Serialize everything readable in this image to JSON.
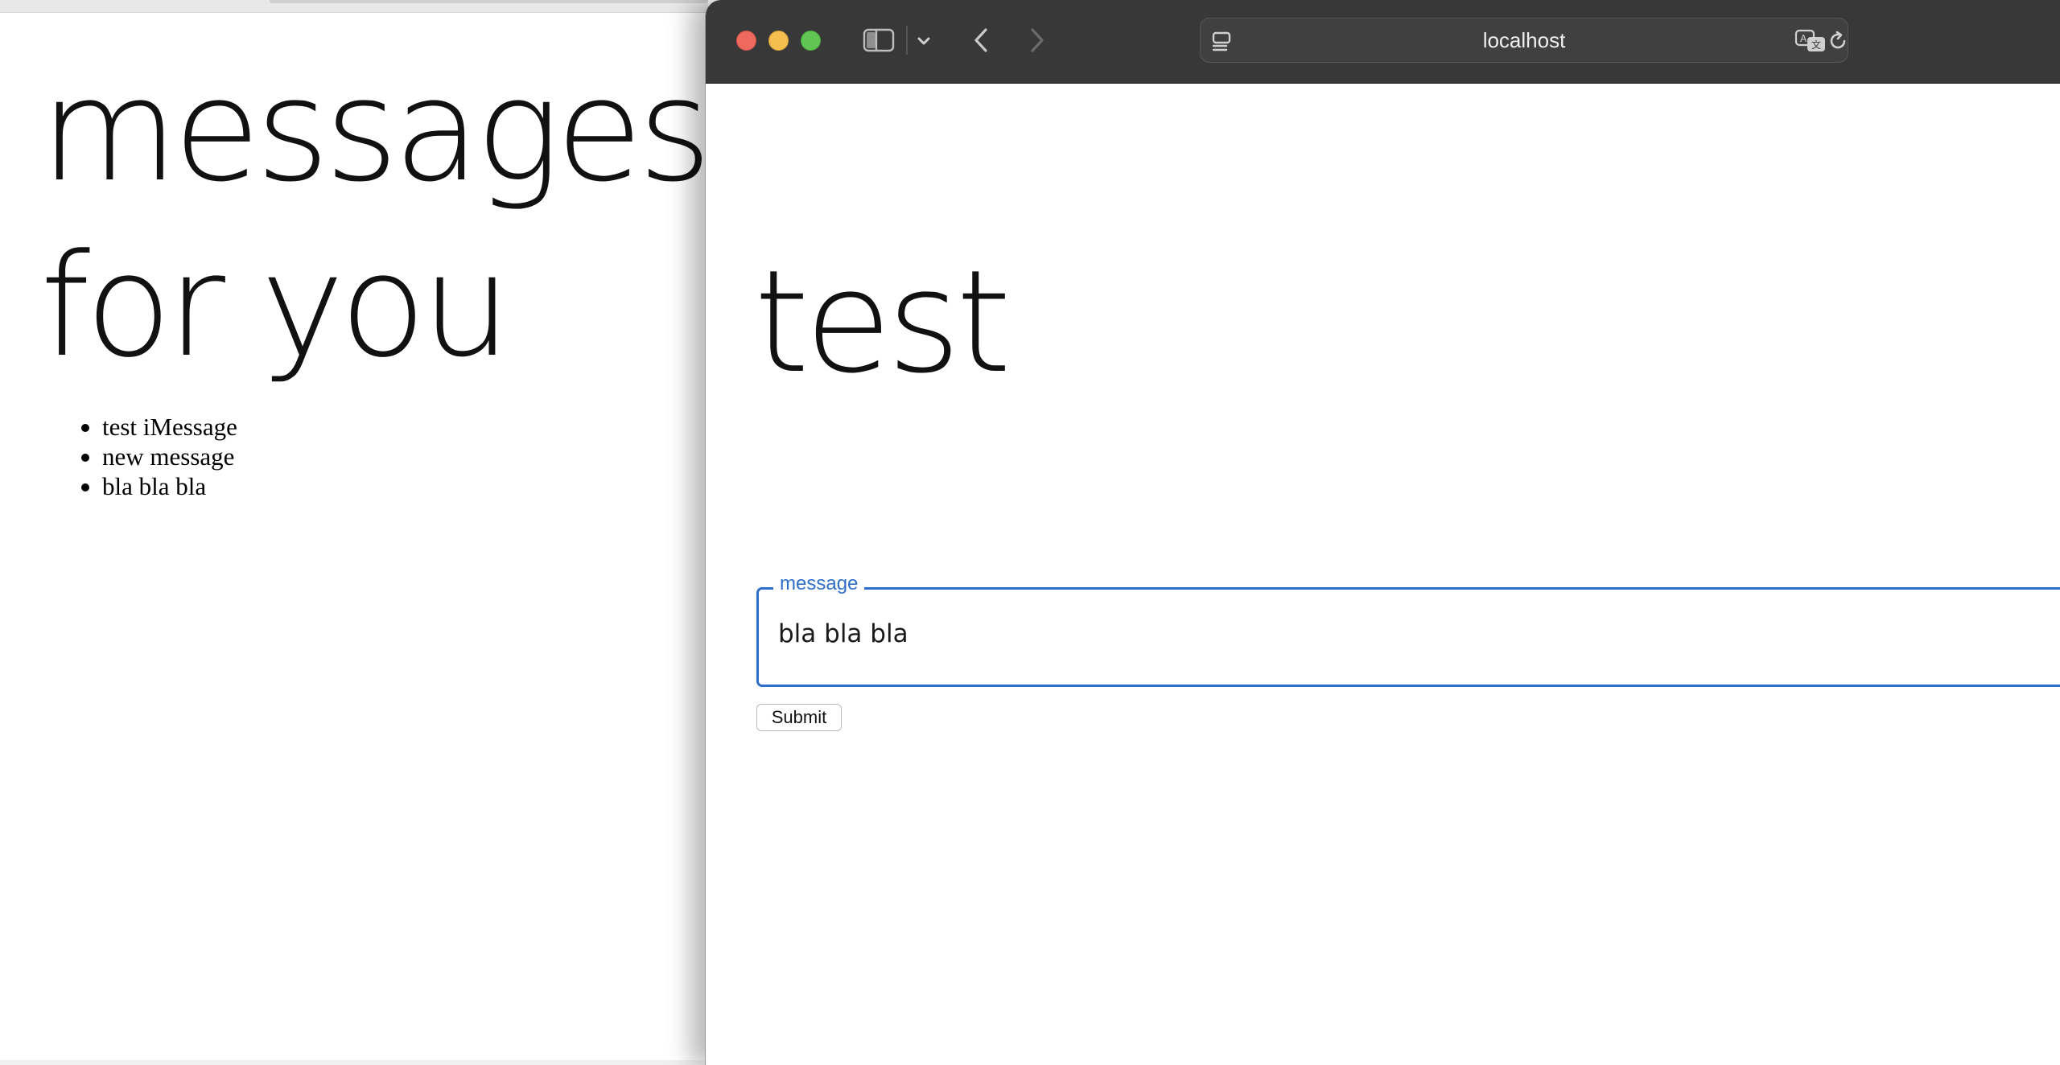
{
  "background_window": {
    "heading_line1": "messages",
    "heading_line2": "for you",
    "messages": [
      "test iMessage",
      "new message",
      "bla bla bla"
    ]
  },
  "browser": {
    "url": "localhost",
    "icons": {
      "close": "close-icon",
      "minimize": "minimize-icon",
      "maximize": "maximize-icon",
      "sidebar": "sidebar-icon",
      "sidebar_menu": "chevron-down-icon",
      "back": "chevron-left-icon",
      "forward": "chevron-right-icon",
      "page_menu": "page-menu-icon",
      "translate": "translate-icon",
      "reload": "reload-icon"
    },
    "colors": {
      "titlebar": "#383838",
      "close": "#ee6a5f",
      "minimize": "#f5bf4f",
      "maximize": "#61c554",
      "accent": "#2f6fc7"
    }
  },
  "page": {
    "title": "test",
    "form": {
      "field_label": "message",
      "field_value": "bla bla bla",
      "submit_label": "Submit"
    }
  }
}
